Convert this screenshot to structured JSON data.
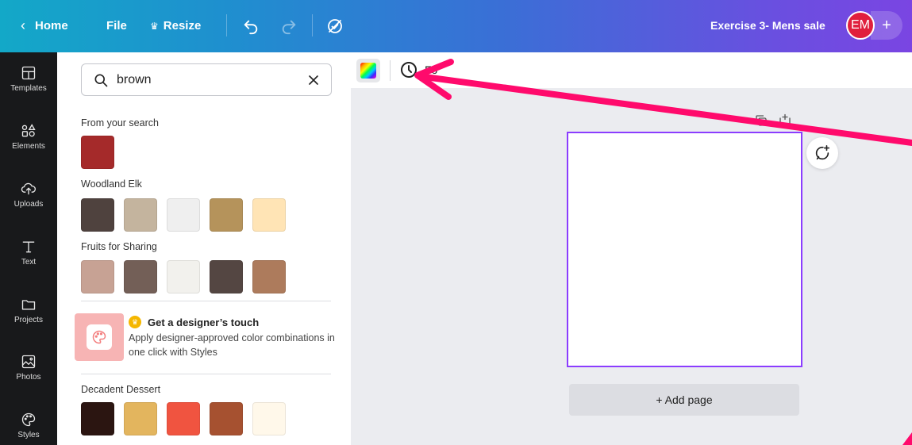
{
  "topbar": {
    "home_label": "Home",
    "file_label": "File",
    "resize_label": "Resize",
    "document_title": "Exercise 3- Mens sale",
    "avatar_initials": "EM",
    "add_label": "+"
  },
  "rail": {
    "items": [
      {
        "label": "Templates",
        "icon": "templates-icon"
      },
      {
        "label": "Elements",
        "icon": "elements-icon"
      },
      {
        "label": "Uploads",
        "icon": "uploads-icon"
      },
      {
        "label": "Text",
        "icon": "text-icon"
      },
      {
        "label": "Projects",
        "icon": "projects-icon"
      },
      {
        "label": "Photos",
        "icon": "photos-icon"
      },
      {
        "label": "Styles",
        "icon": "styles-icon"
      }
    ]
  },
  "panel": {
    "search": {
      "value": "brown"
    },
    "sections": [
      {
        "label": "From your search",
        "colors": [
          "#a52a2a"
        ]
      },
      {
        "label": "Woodland Elk",
        "colors": [
          "#4f423e",
          "#c4b49e",
          "#efefef",
          "#b5935b",
          "#ffe4b5"
        ]
      },
      {
        "label": "Fruits for Sharing",
        "colors": [
          "#c7a294",
          "#735f57",
          "#f2f1ed",
          "#544642",
          "#ad7b5c"
        ]
      },
      {
        "label": "Decadent Dessert",
        "colors": [
          "#2b1511",
          "#e3b55e",
          "#f05440",
          "#a65130",
          "#fff8ea"
        ]
      }
    ],
    "promo": {
      "title": "Get a designer’s touch",
      "description": "Apply designer-approved color combinations in one click with Styles"
    }
  },
  "editor": {
    "toolbar_partial_label": "Fo",
    "add_page_label": "+ Add page"
  },
  "colors": {
    "accent_purple": "#8b3dff",
    "annotation_arrow": "#ff0a6c",
    "rail_bg": "#18191b"
  }
}
